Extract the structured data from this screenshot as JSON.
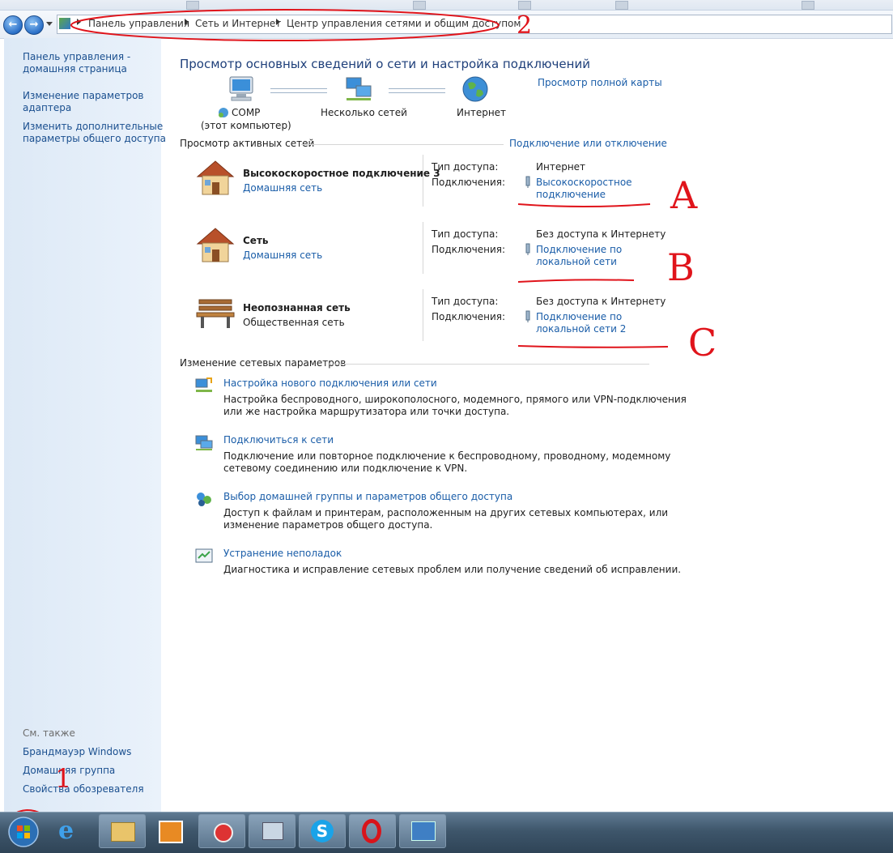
{
  "nav": {
    "back_glyph": "←",
    "forward_glyph": "→"
  },
  "breadcrumb": {
    "items": [
      "Панель управления",
      "Сеть и Интернет",
      "Центр управления сетями и общим доступом"
    ]
  },
  "sidebar": {
    "links": [
      {
        "label_line1": "Панель управления -",
        "label_line2": "домашняя страница"
      },
      {
        "label_line1": "Изменение параметров",
        "label_line2": "адаптера"
      },
      {
        "label_line1": "Изменить дополнительные",
        "label_line2": "параметры общего доступа"
      }
    ],
    "see_also_title": "См. также",
    "see_also": [
      "Брандмауэр Windows",
      "Домашняя группа",
      "Свойства обозревателя"
    ]
  },
  "main": {
    "title": "Просмотр основных сведений о сети и настройка подключений",
    "full_map_link": "Просмотр полной карты",
    "map": {
      "computer": "COMP",
      "computer_sub": "(этот компьютер)",
      "networks": "Несколько сетей",
      "internet": "Интернет"
    },
    "active_title": "Просмотр активных сетей",
    "connect_link": "Подключение или отключение",
    "access_label": "Тип доступа:",
    "conn_label": "Подключения:",
    "networks": [
      {
        "name": "Высокоскоростное подключение  3",
        "type": "Домашняя сеть",
        "type_is_link": true,
        "access": "Интернет",
        "conn_line1": "Высокоскоростное",
        "conn_line2": "подключение",
        "icon": "house-icon"
      },
      {
        "name": "Сеть",
        "type": "Домашняя сеть",
        "type_is_link": true,
        "access": "Без доступа к Интернету",
        "conn_line1": "Подключение по",
        "conn_line2": "локальной сети",
        "icon": "house-icon"
      },
      {
        "name": "Неопознанная сеть",
        "type": "Общественная сеть",
        "type_is_link": false,
        "access": "Без доступа к Интернету",
        "conn_line1": "Подключение по",
        "conn_line2": "локальной сети 2",
        "icon": "bench-icon"
      }
    ],
    "change_title": "Изменение сетевых параметров",
    "tasks": [
      {
        "title": "Настройка нового подключения или сети",
        "desc1": "Настройка беспроводного, широкополосного, модемного, прямого или VPN-подключения",
        "desc2": "или же настройка маршрутизатора или точки доступа."
      },
      {
        "title": "Подключиться к сети",
        "desc1": "Подключение или повторное подключение к беспроводному, проводному, модемному",
        "desc2": "сетевому соединению или подключение к VPN."
      },
      {
        "title": "Выбор домашней группы и параметров общего доступа",
        "desc1": "Доступ к файлам и принтерам, расположенным на других сетевых компьютерах, или",
        "desc2": "изменение параметров общего доступа."
      },
      {
        "title": "Устранение неполадок",
        "desc1": "Диагностика и исправление сетевых проблем или получение сведений об исправлении.",
        "desc2": ""
      }
    ]
  },
  "annotations": {
    "a": "A",
    "b": "B",
    "c": "C",
    "one": "1",
    "two": "2"
  },
  "colors": {
    "link": "#1a5da8",
    "annotation": "#e0141b",
    "sidebar": "#dde9f6"
  }
}
